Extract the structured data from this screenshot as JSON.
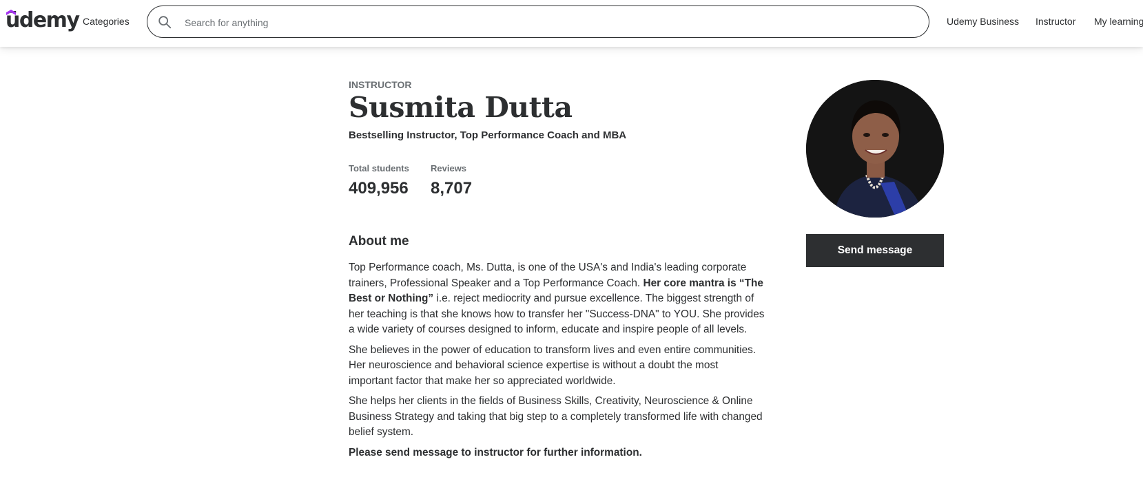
{
  "header": {
    "logo_text": "ūdemy",
    "categories_label": "Categories",
    "search": {
      "placeholder": "Search for anything",
      "value": ""
    },
    "links": [
      "Udemy Business",
      "Instructor",
      "My learning"
    ]
  },
  "profile": {
    "eyebrow": "INSTRUCTOR",
    "name": "Susmita Dutta",
    "headline": "Bestselling Instructor, Top Performance Coach and MBA",
    "stats": [
      {
        "label": "Total students",
        "value": "409,956"
      },
      {
        "label": "Reviews",
        "value": "8,707"
      }
    ],
    "about_title": "About me",
    "bio": {
      "p1_a": "Top Performance coach, Ms. Dutta, is one of the USA's and India's leading corporate trainers, Professional Speaker and a Top Performance Coach. ",
      "p1_bold": "Her core mantra is “The Best or Nothing”",
      "p1_b": " i.e. reject mediocrity and pursue excellence. The biggest strength of her teaching is that she knows how to transfer her \"Success-DNA\" to YOU. She provides a wide variety of courses designed to inform, educate and inspire people of all levels.",
      "p2": "She believes in the power of education to transform lives and even entire communities. Her neuroscience and behavioral science expertise is without a doubt the most important factor that make her so appreciated worldwide.",
      "p3": "She helps her clients in the fields of Business Skills, Creativity, Neuroscience & Online Business Strategy and taking that big step to a completely transformed life with changed belief system.",
      "p4_bold": "Please send message to instructor for further information."
    },
    "send_message_label": "Send message"
  },
  "colors": {
    "brand_purple": "#a435f0",
    "text": "#2d2f31",
    "muted": "#6a6f73"
  },
  "icons": {
    "search": "search-icon",
    "avatar": "instructor-photo"
  }
}
